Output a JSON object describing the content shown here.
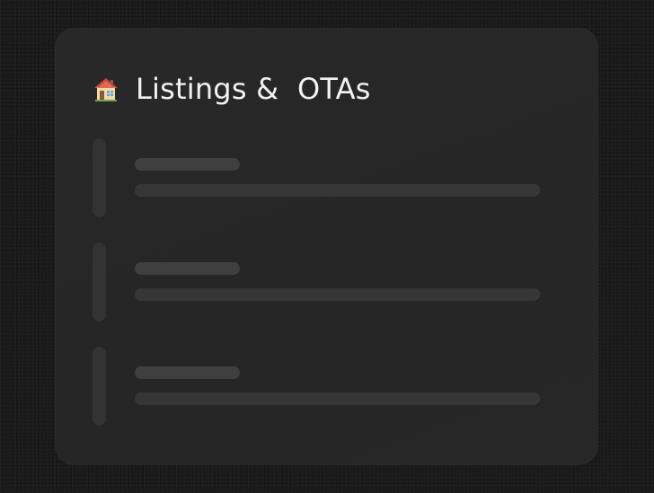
{
  "card": {
    "title": "Listings &  OTAs",
    "icon": "house-icon"
  },
  "skeleton_rows": [
    {
      "state": "loading"
    },
    {
      "state": "loading"
    },
    {
      "state": "loading"
    }
  ]
}
